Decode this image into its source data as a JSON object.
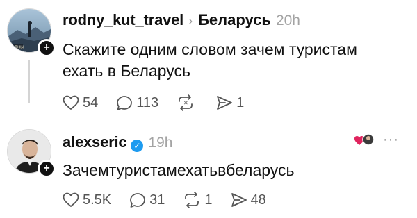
{
  "posts": [
    {
      "username": "rodny_kut_travel",
      "community": "Беларусь",
      "time": "20h",
      "text_lines": [
        "Скажите одним словом зачем туристам",
        "ехать в Беларусь"
      ],
      "likes": "54",
      "replies": "113",
      "reposts": "",
      "shares": "1",
      "avatar_caption": "РОДНЫ"
    },
    {
      "username": "alexseric",
      "time": "19h",
      "text": "Зачемтуристамехатьвбеларусь",
      "likes": "5.5K",
      "replies": "31",
      "reposts": "1",
      "shares": "48"
    }
  ],
  "icons": {
    "like": "heart-icon",
    "reply": "comment-icon",
    "repost": "repost-icon",
    "share": "send-icon",
    "follow": "plus-icon",
    "verified": "verified-check-icon",
    "more": "more-icon"
  },
  "colors": {
    "text": "#111111",
    "muted": "#555555",
    "timestamp": "#a3a3a3",
    "verified": "#1d9bf0",
    "liked_heart": "#e0245e"
  }
}
